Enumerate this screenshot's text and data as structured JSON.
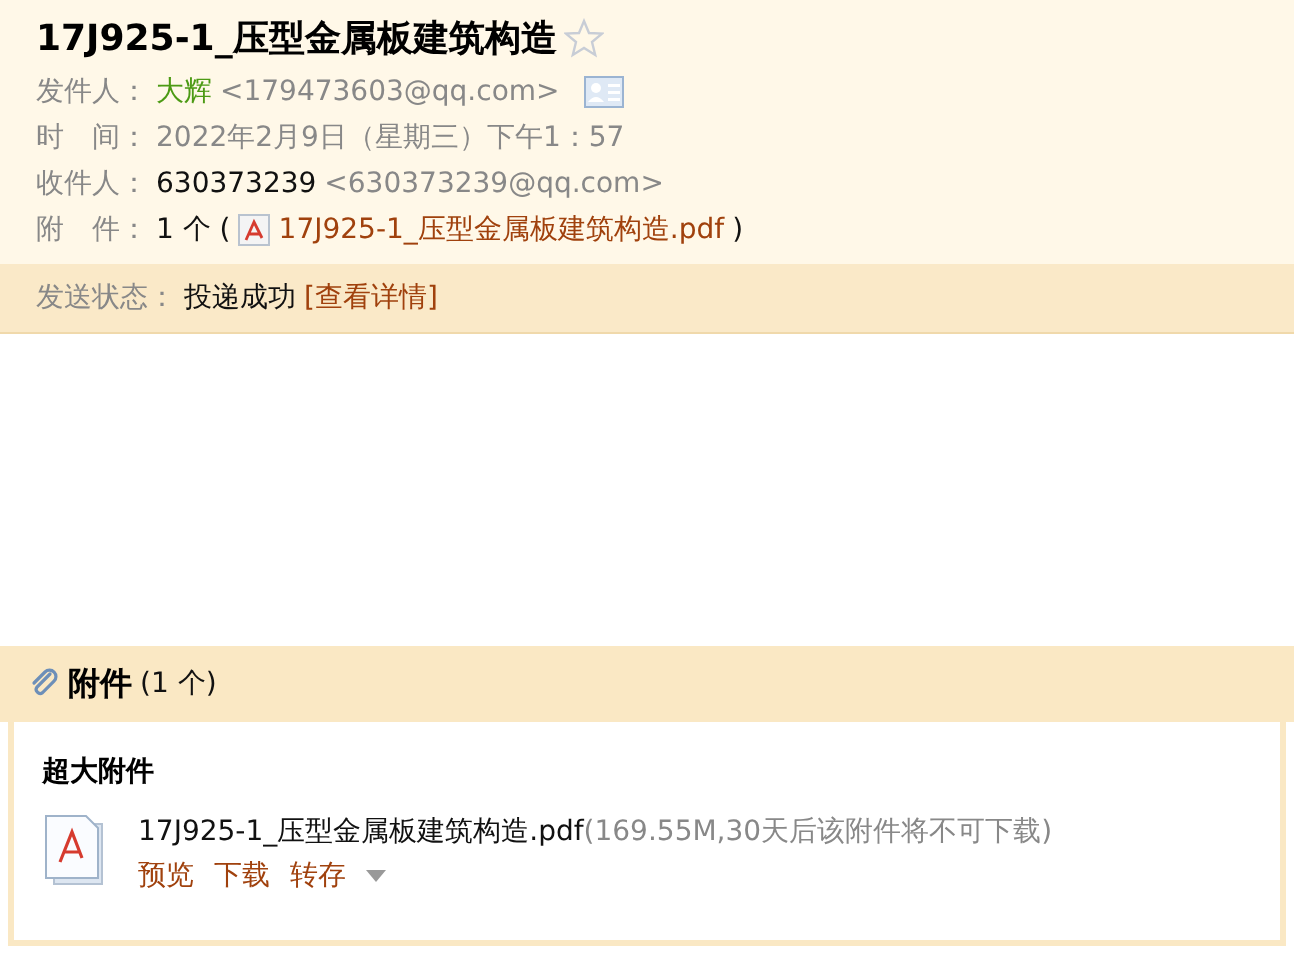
{
  "subject": "17J925-1_压型金属板建筑构造",
  "starred": false,
  "fields": [
    {
      "kind": "sender",
      "label": "发件人：",
      "name": "大辉",
      "address": "<179473603@qq.com>"
    },
    {
      "kind": "time",
      "label": "时　间：",
      "value": "2022年2月9日（星期三）下午1：57"
    },
    {
      "kind": "recipient",
      "label": "收件人：",
      "name": "630373239",
      "address": "<630373239@qq.com>"
    },
    {
      "kind": "attachment",
      "label": "附　件：",
      "count": "1 个 (",
      "file": "17J925-1_压型金属板建筑构造.pdf",
      "close": ")"
    }
  ],
  "status": {
    "label": "发送状态：",
    "value": "投递成功",
    "link": "[查看详情]"
  },
  "attachments": {
    "title": "附件",
    "count": "(1 个)",
    "section": "超大附件",
    "files": [
      {
        "name": "17J925-1_压型金属板建筑构造.pdf",
        "info": "(169.55M,30天后该附件将不可下载)",
        "actions": [
          "预览",
          "下载",
          "转存"
        ]
      }
    ]
  }
}
